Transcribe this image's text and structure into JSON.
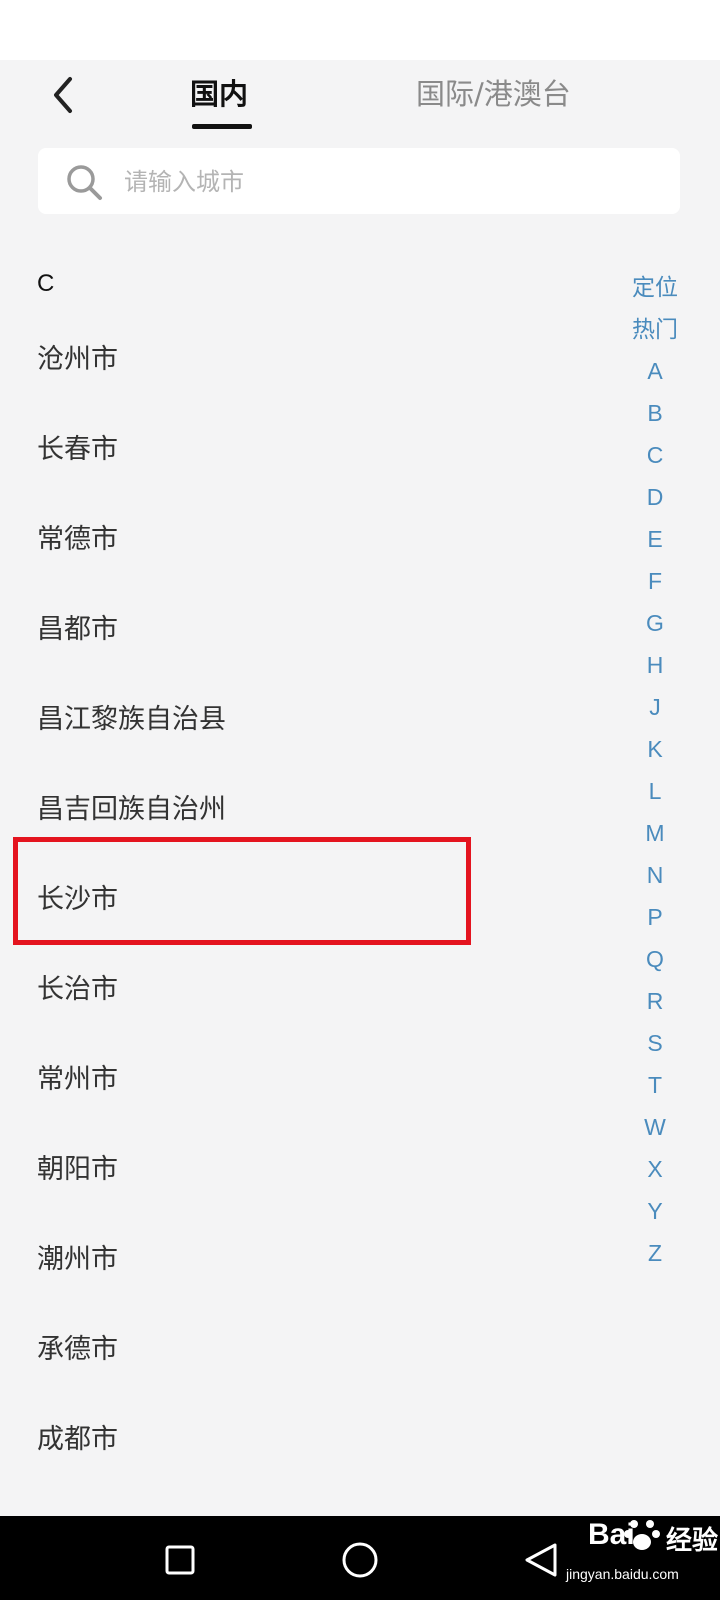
{
  "header": {
    "tabs": [
      {
        "label": "国内",
        "active": true
      },
      {
        "label": "国际/港澳台",
        "active": false
      }
    ]
  },
  "search": {
    "placeholder": "请输入城市",
    "value": ""
  },
  "section": {
    "letter": "C",
    "cities": [
      "沧州市",
      "长春市",
      "常德市",
      "昌都市",
      "昌江黎族自治县",
      "昌吉回族自治州",
      "长沙市",
      "长治市",
      "常州市",
      "朝阳市",
      "潮州市",
      "承德市",
      "成都市"
    ],
    "highlighted_city": "长沙市"
  },
  "alpha_index": [
    "定位",
    "热门",
    "A",
    "B",
    "C",
    "D",
    "E",
    "F",
    "G",
    "H",
    "J",
    "K",
    "L",
    "M",
    "N",
    "P",
    "Q",
    "R",
    "S",
    "T",
    "W",
    "X",
    "Y",
    "Z"
  ],
  "watermark": {
    "brand": "Bai",
    "brand_cn": "经验",
    "url": "jingyan.baidu.com"
  },
  "icons": {
    "back": "chevron-left-icon",
    "search": "search-icon",
    "nav_recent": "square-icon",
    "nav_home": "circle-icon",
    "nav_back": "triangle-back-icon"
  },
  "colors": {
    "accent_index": "#4a8bbd",
    "highlight": "#e4141f",
    "background": "#f4f4f5"
  }
}
